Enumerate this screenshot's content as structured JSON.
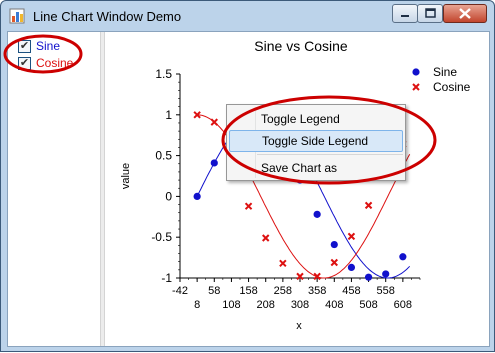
{
  "window": {
    "title": "Line Chart Window Demo",
    "icon": "app-chart-icon",
    "controls": [
      "minimize-icon",
      "maximize-icon",
      "close-icon"
    ]
  },
  "side_legend": {
    "items": [
      {
        "label": "Sine",
        "checked": true,
        "color": "#1111cc"
      },
      {
        "label": "Cosine",
        "checked": true,
        "color": "#dd1111"
      }
    ]
  },
  "context_menu": {
    "items": [
      {
        "label": "Toggle Legend",
        "highlighted": false
      },
      {
        "label": "Toggle Side Legend",
        "highlighted": true
      },
      {
        "label": "Save Chart as",
        "highlighted": false
      }
    ]
  },
  "annotations": {
    "color": "#cc0000"
  },
  "chart_data": {
    "type": "line",
    "title": "Sine vs Cosine",
    "xlabel": "x",
    "ylabel": "value",
    "xlim": [
      -42,
      658
    ],
    "ylim": [
      -1,
      1.5
    ],
    "x_ticks_top": [
      "-42",
      "58",
      "158",
      "258",
      "358",
      "458",
      "558"
    ],
    "x_ticks_bottom": [
      "8",
      "108",
      "208",
      "308",
      "408",
      "508",
      "608"
    ],
    "y_ticks": [
      "1.5",
      "1",
      "0.5",
      "0",
      "-0.5",
      "-1"
    ],
    "legend_placement": "top-right",
    "series": [
      {
        "name": "Sine",
        "color": "#1111cc",
        "marker": "circle",
        "x": [
          8,
          58,
          108,
          158,
          208,
          258,
          308,
          358,
          408,
          458,
          508,
          558,
          608
        ],
        "y": [
          0,
          0.41,
          0.75,
          0.96,
          1.0,
          0.85,
          0.2,
          -0.22,
          -0.59,
          -0.87,
          -0.99,
          -0.95,
          -0.74
        ]
      },
      {
        "name": "Cosine",
        "color": "#dd1111",
        "marker": "x",
        "x": [
          8,
          58,
          108,
          158,
          208,
          258,
          308,
          358,
          408,
          458,
          508,
          558,
          608
        ],
        "y": [
          1.0,
          0.91,
          0.66,
          -0.12,
          -0.51,
          -0.82,
          -0.98,
          -0.98,
          -0.81,
          -0.49,
          -0.11,
          0.28,
          0.64
        ]
      }
    ]
  }
}
